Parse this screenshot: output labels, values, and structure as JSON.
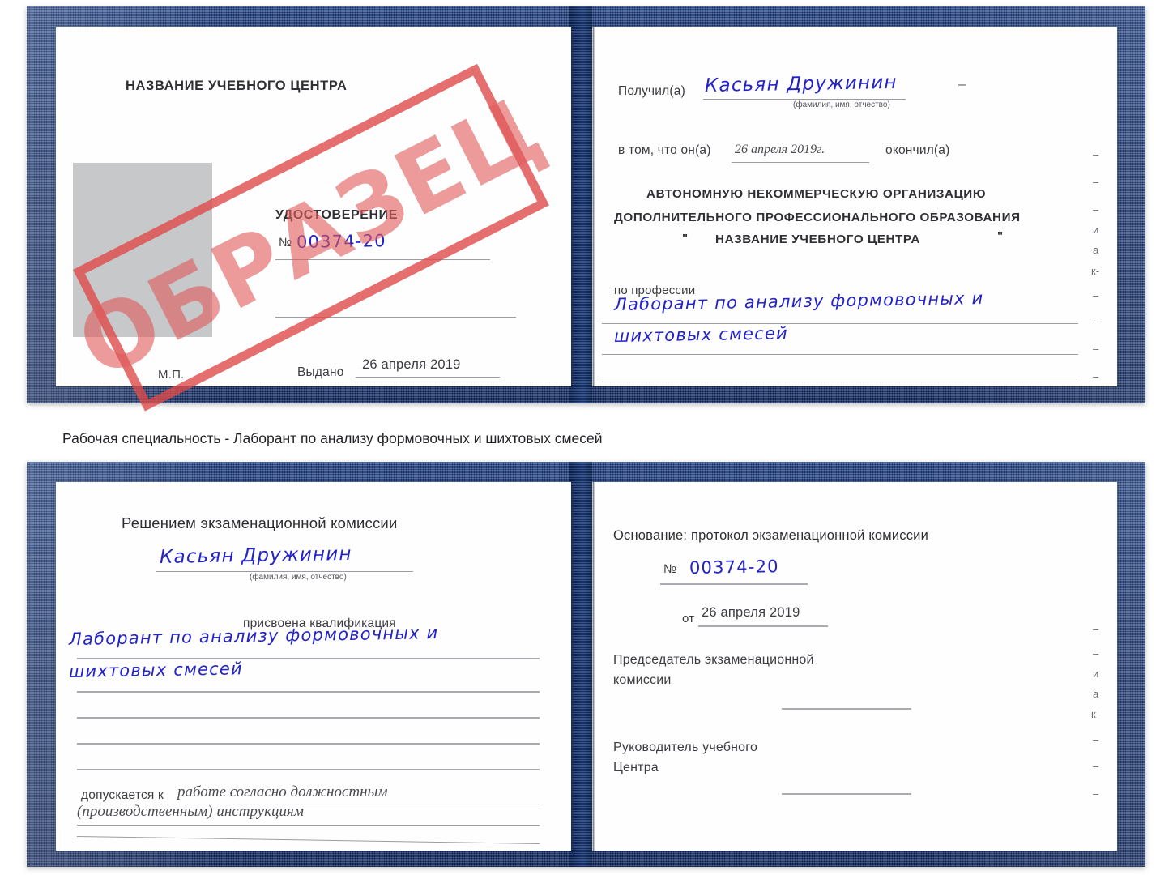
{
  "meta": {
    "caption": "Рабочая специальность - Лаборант по анализу формовочных и шихтовых смесей",
    "stamp_text": "ОБРАЗЕЦ",
    "accent_blue": "#1d3b7d",
    "stamp_red": "#de4a4a",
    "ink_blue": "#2323c8"
  },
  "certificate_top": {
    "left_page": {
      "org_title": "НАЗВАНИЕ УЧЕБНОГО ЦЕНТРА",
      "doc_title": "УДОСТОВЕРЕНИЕ",
      "number_label": "№",
      "number_value": "00374-20",
      "issued_label": "Выдано",
      "issued_value": "26 апреля 2019",
      "seal_label": "М.П.",
      "photo_placeholder": "photo-box"
    },
    "right_page": {
      "received_label": "Получил(а)",
      "received_value": "Касьян Дружинин",
      "fio_hint": "(фамилия, имя, отчество)",
      "in_that_label": "в том, что он(а)",
      "in_that_value": "26 апреля 2019г.",
      "finished_label": "окончил(а)",
      "org_line1": "АВТОНОМНУЮ НЕКОММЕРЧЕСКУЮ ОРГАНИЗАЦИЮ",
      "org_line2": "ДОПОЛНИТЕЛЬНОГО ПРОФЕССИОНАЛЬНОГО ОБРАЗОВАНИЯ",
      "org_quote_open": "\"",
      "org_name": "НАЗВАНИЕ УЧЕБНОГО ЦЕНТРА",
      "org_quote_close": "\"",
      "profession_label": "по профессии",
      "profession_value_line1": "Лаборант по анализу формовочных и",
      "profession_value_line2": "шихтовых смесей",
      "edge_fragments": [
        "–",
        "–",
        "–",
        "и",
        "а",
        "к-",
        "–",
        "–",
        "–",
        "–"
      ]
    }
  },
  "certificate_bottom": {
    "left_page": {
      "commission_title": "Решением экзаменационной комиссии",
      "name_value": "Касьян Дружинин",
      "fio_hint": "(фамилия, имя, отчество)",
      "qualification_label": "присвоена квалификация",
      "qualification_line1": "Лаборант по анализу формовочных и",
      "qualification_line2": "шихтовых смесей",
      "admitted_label": "допускается к",
      "admitted_line1": "работе согласно должностным",
      "admitted_line2": "(производственным) инструкциям"
    },
    "right_page": {
      "basis_label": "Основание: протокол экзаменационной комиссии",
      "number_label": "№",
      "number_value": "00374-20",
      "date_label": "от",
      "date_value": "26 апреля 2019",
      "chairman_line1": "Председатель экзаменационной",
      "chairman_line2": "комиссии",
      "head_line1": "Руководитель учебного",
      "head_line2": "Центра",
      "edge_fragments": [
        "–",
        "–",
        "и",
        "а",
        "к-",
        "–",
        "–",
        "–"
      ]
    }
  }
}
